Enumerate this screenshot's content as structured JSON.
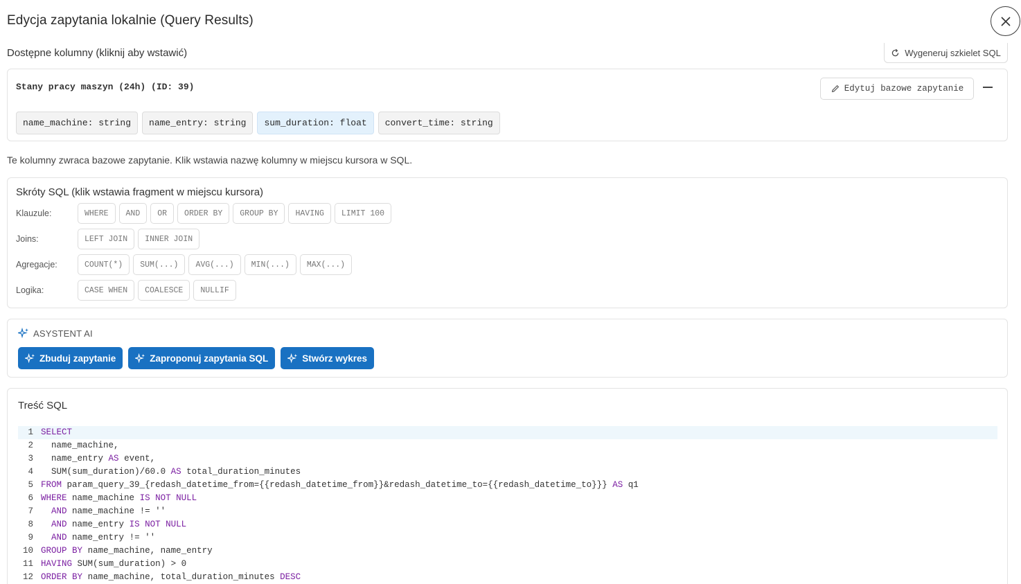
{
  "modal": {
    "title": "Edycja zapytania lokalnie (Query Results)",
    "close_icon": "close-icon"
  },
  "columns_section": {
    "label": "Dostępne kolumny (kliknij aby wstawić)",
    "regenerate_label": "Wygeneruj szkielet SQL",
    "source_name": "Stany pracy maszyn (24h) (ID: 39)",
    "edit_base_label": "Edytuj bazowe zapytanie",
    "columns": [
      {
        "label": "name_machine: string",
        "highlighted": false
      },
      {
        "label": "name_entry: string",
        "highlighted": false
      },
      {
        "label": "sum_duration: float",
        "highlighted": true
      },
      {
        "label": "convert_time: string",
        "highlighted": false
      }
    ],
    "hint": "Te kolumny zwraca bazowe zapytanie. Klik wstawia nazwę kolumny w miejscu kursora w SQL."
  },
  "shortcuts": {
    "title": "Skróty SQL (klik wstawia fragment w miejscu kursora)",
    "groups": [
      {
        "label": "Klauzule:",
        "items": [
          "WHERE",
          "AND",
          "OR",
          "ORDER BY",
          "GROUP BY",
          "HAVING",
          "LIMIT 100"
        ]
      },
      {
        "label": "Joins:",
        "items": [
          "LEFT JOIN",
          "INNER JOIN"
        ]
      },
      {
        "label": "Agregacje:",
        "items": [
          "COUNT(*)",
          "SUM(...)",
          "AVG(...)",
          "MIN(...)",
          "MAX(...)"
        ]
      },
      {
        "label": "Logika:",
        "items": [
          "CASE WHEN",
          "COALESCE",
          "NULLIF"
        ]
      }
    ]
  },
  "ai": {
    "header": "ASYSTENT AI",
    "buttons": [
      "Zbuduj zapytanie",
      "Zaproponuj zapytania SQL",
      "Stwórz wykres"
    ]
  },
  "sql": {
    "title": "Treść SQL",
    "active_line": 1,
    "lines": [
      "SELECT",
      "  name_machine,",
      "  name_entry AS event,",
      "  SUM(sum_duration)/60.0 AS total_duration_minutes",
      "FROM param_query_39_{redash_datetime_from={{redash_datetime_from}}&redash_datetime_to={{redash_datetime_to}}} AS q1",
      "WHERE name_machine IS NOT NULL",
      "  AND name_machine != ''",
      "  AND name_entry IS NOT NULL",
      "  AND name_entry != ''",
      "GROUP BY name_machine, name_entry",
      "HAVING SUM(sum_duration) > 0",
      "ORDER BY name_machine, total_duration_minutes DESC"
    ],
    "keywords": [
      "SELECT",
      "FROM",
      "WHERE",
      "AND",
      "IS",
      "NOT",
      "NULL",
      "GROUP",
      "BY",
      "HAVING",
      "ORDER",
      "AS",
      "DESC"
    ]
  },
  "colors": {
    "accent": "#1971c2",
    "keyword": "#7b1fa2",
    "chip_highlight": "#e3f1fc"
  }
}
